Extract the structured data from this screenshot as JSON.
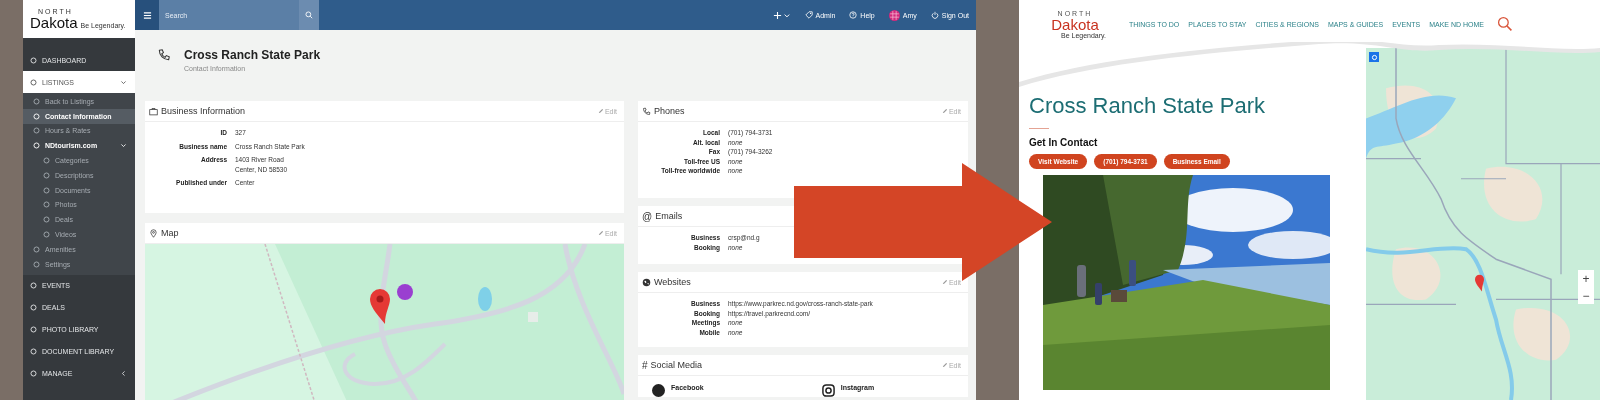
{
  "admin": {
    "logo": {
      "small": "NORTH",
      "brand": "Dakota",
      "tagline": "Be Legendary."
    },
    "sidebar": [
      {
        "label": "DASHBOARD",
        "selected": false
      },
      {
        "label": "LISTINGS",
        "selected": true,
        "expanded": true,
        "children": [
          {
            "label": "Back to Listings",
            "selected": false
          },
          {
            "label": "Contact Information",
            "selected": true
          },
          {
            "label": "Hours & Rates",
            "selected": false
          },
          {
            "label": "NDtourism.com",
            "selected": false,
            "expanded": true,
            "children": [
              {
                "label": "Categories",
                "selected": false
              },
              {
                "label": "Descriptions",
                "selected": false
              },
              {
                "label": "Documents",
                "selected": false
              },
              {
                "label": "Photos",
                "selected": false
              },
              {
                "label": "Deals",
                "selected": false
              },
              {
                "label": "Videos",
                "selected": false
              }
            ]
          },
          {
            "label": "Amenities",
            "selected": false
          },
          {
            "label": "Settings",
            "selected": false
          }
        ]
      },
      {
        "label": "EVENTS",
        "selected": false
      },
      {
        "label": "DEALS",
        "selected": false
      },
      {
        "label": "PHOTO LIBRARY",
        "selected": false
      },
      {
        "label": "DOCUMENT LIBRARY",
        "selected": false
      },
      {
        "label": "MANAGE",
        "selected": false,
        "expanded": false
      }
    ],
    "search": {
      "placeholder": "Search"
    },
    "top_actions": [
      {
        "label": "Admin",
        "kind": "tag"
      },
      {
        "label": "Help",
        "kind": "help"
      },
      {
        "label": "Amy",
        "kind": "avatar"
      },
      {
        "label": "Sign Out",
        "kind": "power"
      }
    ],
    "page": {
      "title": "Cross Ranch State Park",
      "subtitle": "Contact Information"
    },
    "left_cards": [
      {
        "title": "Business Information",
        "edit": "Edit",
        "kind": "fields",
        "rows": [
          {
            "label": "ID",
            "value": [
              "327"
            ]
          },
          {
            "label": "Business name",
            "value": [
              "Cross Ranch State Park"
            ]
          },
          {
            "label": "Address",
            "value": [
              "1403 River Road",
              "Center, ND 58530"
            ]
          },
          {
            "label": "Published under",
            "value": [
              "Center"
            ]
          }
        ]
      },
      {
        "title": "Map",
        "edit": "Edit",
        "kind": "map"
      }
    ],
    "right_cards": [
      {
        "title": "Phones",
        "edit": "Edit",
        "kind": "fields",
        "rows": [
          {
            "label": "Local",
            "value": [
              "(701) 794-3731"
            ],
            "empty": false
          },
          {
            "label": "Alt. local",
            "value": [
              "none"
            ],
            "empty": true
          },
          {
            "label": "Fax",
            "value": [
              "(701) 794-3262"
            ],
            "empty": false
          },
          {
            "label": "Toll-free US",
            "value": [
              "none"
            ],
            "empty": true
          },
          {
            "label": "Toll-free worldwide",
            "value": [
              "none"
            ],
            "empty": true
          }
        ]
      },
      {
        "title": "Emails",
        "symbol": "@",
        "kind": "fields",
        "rows": [
          {
            "label": "Business",
            "value": [
              "crsp@nd.g"
            ],
            "empty": false
          },
          {
            "label": "Booking",
            "value": [
              "none"
            ],
            "empty": true
          }
        ]
      },
      {
        "title": "Websites",
        "edit": "Edit",
        "kind": "fields",
        "rows": [
          {
            "label": "Business",
            "value": [
              "https://www.parkrec.nd.gov/cross-ranch-state-park"
            ],
            "empty": false
          },
          {
            "label": "Booking",
            "value": [
              "https://travel.parkrecnd.com/"
            ],
            "empty": false
          },
          {
            "label": "Meetings",
            "value": [
              "none"
            ],
            "empty": true
          },
          {
            "label": "Mobile",
            "value": [
              "none"
            ],
            "empty": true
          }
        ]
      },
      {
        "title": "Social Media",
        "symbol": "#",
        "edit": "Edit",
        "kind": "social",
        "items": [
          {
            "label": "Facebook"
          },
          {
            "label": "Instagram"
          }
        ]
      }
    ]
  },
  "site": {
    "logo": {
      "small": "NORTH",
      "brand": "Dakota",
      "tagline": "Be Legendary."
    },
    "nav": [
      "THINGS TO DO",
      "PLACES TO STAY",
      "CITIES & REGIONS",
      "MAPS & GUIDES",
      "EVENTS",
      "MAKE ND HOME"
    ],
    "title": "Cross Ranch State Park",
    "subtitle": "Get In Contact",
    "buttons": [
      "Visit Website",
      "(701) 794-3731",
      "Business Email"
    ],
    "photo": {
      "kind": "picture"
    },
    "map": {
      "kind": "picture",
      "zoom_controls": [
        "+",
        "−"
      ]
    }
  }
}
